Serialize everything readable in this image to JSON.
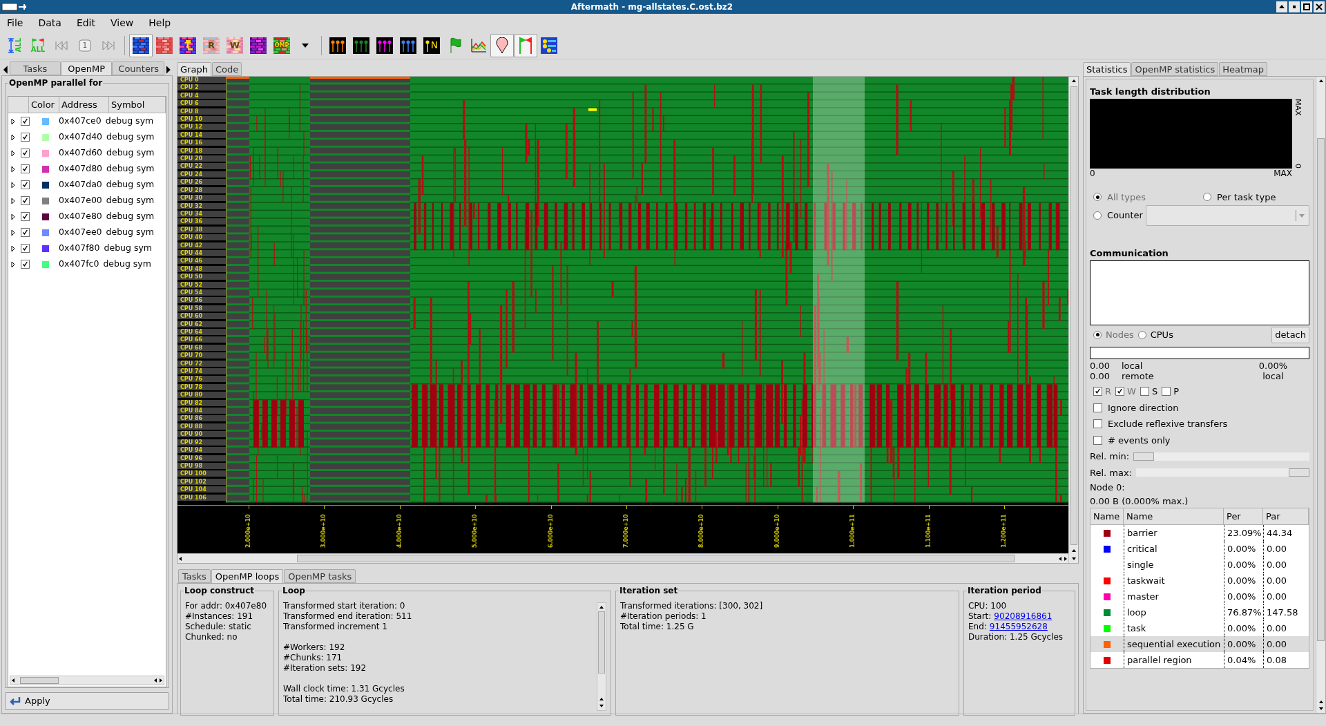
{
  "window": {
    "title": "Aftermath - mg-allstates.C.ost.bz2"
  },
  "menu": [
    "File",
    "Data",
    "Edit",
    "View",
    "Help"
  ],
  "toolbar": [
    {
      "kind": "all-range",
      "label": "ALL",
      "selected": false
    },
    {
      "kind": "all-flags",
      "label": "ALL",
      "selected": false
    },
    {
      "kind": "skip-start",
      "selected": false
    },
    {
      "kind": "page",
      "label": "1",
      "selected": false
    },
    {
      "kind": "skip-end",
      "selected": false
    },
    {
      "kind": "sep"
    },
    {
      "kind": "mode-state",
      "selected": true
    },
    {
      "kind": "mode-type",
      "selected": false
    },
    {
      "kind": "mode-typed",
      "label": "T",
      "selected": false
    },
    {
      "kind": "mode-read",
      "label": "R",
      "selected": false
    },
    {
      "kind": "mode-write",
      "label": "W",
      "selected": false
    },
    {
      "kind": "mode-numa",
      "selected": false
    },
    {
      "kind": "mode-omp",
      "label": "OMP",
      "selected": false
    },
    {
      "kind": "dropdown",
      "selected": false
    },
    {
      "kind": "sep"
    },
    {
      "kind": "pins-orange",
      "selected": false
    },
    {
      "kind": "pins-green",
      "selected": false
    },
    {
      "kind": "pins-magenta",
      "selected": false
    },
    {
      "kind": "pins-blue",
      "selected": false
    },
    {
      "kind": "pins-n",
      "label": "N",
      "selected": false
    },
    {
      "kind": "flag",
      "selected": false
    },
    {
      "kind": "chart",
      "selected": false
    },
    {
      "kind": "marker",
      "selected": true
    },
    {
      "kind": "flags",
      "selected": true
    },
    {
      "kind": "overview",
      "selected": false
    }
  ],
  "left_tabs": [
    {
      "label": "Tasks",
      "selected": false
    },
    {
      "label": "OpenMP",
      "selected": true
    },
    {
      "label": "Counters",
      "selected": false
    }
  ],
  "openmp_panel": {
    "title": "OpenMP parallel for",
    "columns": [
      "Color",
      "Address",
      "Symbol"
    ],
    "rows": [
      {
        "checked": true,
        "color": "#66bbff",
        "address": "0x407ce0",
        "symbol": "debug sym"
      },
      {
        "checked": true,
        "color": "#b0ffa8",
        "address": "0x407d40",
        "symbol": "debug sym"
      },
      {
        "checked": true,
        "color": "#ffa0cc",
        "address": "0x407d60",
        "symbol": "debug sym"
      },
      {
        "checked": true,
        "color": "#d030b0",
        "address": "0x407d80",
        "symbol": "debug sym"
      },
      {
        "checked": true,
        "color": "#003060",
        "address": "0x407da0",
        "symbol": "debug sym"
      },
      {
        "checked": true,
        "color": "#808080",
        "address": "0x407e00",
        "symbol": "debug sym"
      },
      {
        "checked": true,
        "color": "#600040",
        "address": "0x407e80",
        "symbol": "debug sym"
      },
      {
        "checked": true,
        "color": "#7088ff",
        "address": "0x407ee0",
        "symbol": "debug sym"
      },
      {
        "checked": true,
        "color": "#6030ff",
        "address": "0x407f80",
        "symbol": "debug sym"
      },
      {
        "checked": true,
        "color": "#40ff80",
        "address": "0x407fc0",
        "symbol": "debug sym"
      }
    ],
    "apply": "Apply"
  },
  "graph_tabs": [
    {
      "label": "Graph",
      "selected": true
    },
    {
      "label": "Code",
      "selected": false
    }
  ],
  "timeline": {
    "cpus": [
      "CPU 0",
      "CPU 2",
      "CPU 4",
      "CPU 6",
      "CPU 8",
      "CPU 10",
      "CPU 12",
      "CPU 14",
      "CPU 16",
      "CPU 18",
      "CPU 20",
      "CPU 22",
      "CPU 24",
      "CPU 26",
      "CPU 28",
      "CPU 30",
      "CPU 32",
      "CPU 34",
      "CPU 36",
      "CPU 38",
      "CPU 40",
      "CPU 42",
      "CPU 44",
      "CPU 46",
      "CPU 48",
      "CPU 50",
      "CPU 52",
      "CPU 54",
      "CPU 56",
      "CPU 58",
      "CPU 60",
      "CPU 62",
      "CPU 64",
      "CPU 66",
      "CPU 68",
      "CPU 70",
      "CPU 72",
      "CPU 74",
      "CPU 76",
      "CPU 78",
      "CPU 80",
      "CPU 82",
      "CPU 84",
      "CPU 86",
      "CPU 88",
      "CPU 90",
      "CPU 92",
      "CPU 94",
      "CPU 96",
      "CPU 98",
      "CPU 100",
      "CPU 102",
      "CPU 104",
      "CPU 106"
    ],
    "axis": [
      "2.000e+10",
      "3.000e+10",
      "4.000e+10",
      "5.000e+10",
      "6.000e+10",
      "7.000e+10",
      "8.000e+10",
      "9.000e+10",
      "1.000e+11",
      "1.100e+11",
      "1.200e+11"
    ]
  },
  "bottom_tabs": [
    {
      "label": "Tasks",
      "selected": false
    },
    {
      "label": "OpenMP loops",
      "selected": true
    },
    {
      "label": "OpenMP tasks",
      "selected": false
    }
  ],
  "loop_construct": {
    "title": "Loop construct",
    "lines": [
      "For addr: 0x407e80",
      "#Instances: 191",
      "Schedule: static",
      "Chunked: no"
    ]
  },
  "loop": {
    "title": "Loop",
    "paragraphs": [
      [
        "Transformed start iteration: 0",
        "Transformed end iteration: 511",
        "Transformed increment 1"
      ],
      [
        "#Workers: 192",
        "#Chunks: 171",
        "#Iteration sets: 192"
      ],
      [
        "Wall clock time: 1.31 Gcycles",
        "Total time: 210.93 Gcycles"
      ]
    ]
  },
  "iteration_set": {
    "title": "Iteration set",
    "lines": [
      "Transformed iterations: [300, 302]",
      "#Iteration periods: 1",
      "Total time: 1.25 G"
    ]
  },
  "iteration_period": {
    "title": "Iteration period",
    "lines": [
      {
        "text": "CPU: 100"
      },
      {
        "text": "Start:",
        "link": "90208916861"
      },
      {
        "text": "End:",
        "link": "91455952628"
      },
      {
        "text": "Duration: 1.25 Gcycles"
      }
    ]
  },
  "right_tabs": [
    {
      "label": "Statistics",
      "selected": true
    },
    {
      "label": "OpenMP statistics",
      "selected": false
    },
    {
      "label": "Heatmap",
      "selected": false
    }
  ],
  "task_length": {
    "title": "Task length distribution",
    "x_min": "0",
    "x_max": "MAX",
    "y_min": "0",
    "y_max": "MAX"
  },
  "type_options": [
    {
      "label": "All types",
      "selected": true
    },
    {
      "label": "Per task type",
      "selected": false
    },
    {
      "label": "Counter",
      "selected": false
    }
  ],
  "communication": {
    "title": "Communication",
    "scope": [
      {
        "label": "Nodes",
        "selected": true
      },
      {
        "label": "CPUs",
        "selected": false
      }
    ],
    "detach": "detach",
    "local_value": "0.00",
    "local_label": "local",
    "remote_value": "0.00",
    "remote_label": "remote",
    "percent": "0.00%",
    "percent_label": "local",
    "access": [
      {
        "label": "R",
        "checked": true
      },
      {
        "label": "W",
        "checked": true
      },
      {
        "label": "S",
        "checked": false
      },
      {
        "label": "P",
        "checked": false
      }
    ],
    "options": [
      {
        "label": "Ignore direction",
        "checked": false
      },
      {
        "label": "Exclude reflexive transfers",
        "checked": false
      },
      {
        "label": "# events only",
        "checked": false
      }
    ],
    "rel_min": {
      "label": "Rel. min:",
      "level": 0
    },
    "rel_max": {
      "label": "Rel. max:",
      "level": 1
    },
    "node_title": "Node 0:",
    "node_value": "0.00 B (0.000% max.)"
  },
  "stats_table": {
    "columns": [
      "Name",
      "Name",
      "Per",
      "Par"
    ],
    "rows": [
      {
        "color": "#a00014",
        "name": "barrier",
        "per": "23.09%",
        "par": "44.34",
        "selected": false
      },
      {
        "color": "#0000ff",
        "name": "critical",
        "per": "0.00%",
        "par": "0.00",
        "selected": false
      },
      {
        "name": "single",
        "per": "0.00%",
        "par": "0.00",
        "selected": false
      },
      {
        "color": "#ff0000",
        "name": "taskwait",
        "per": "0.00%",
        "par": "0.00",
        "selected": false
      },
      {
        "color": "#ff00b0",
        "name": "master",
        "per": "0.00%",
        "par": "0.00",
        "selected": false
      },
      {
        "color": "#008c30",
        "name": "loop",
        "per": "76.87%",
        "par": "147.58",
        "selected": false
      },
      {
        "color": "#00ff00",
        "name": "task",
        "per": "0.00%",
        "par": "0.00",
        "selected": false
      },
      {
        "color": "#ff6000",
        "name": "sequential execution",
        "per": "0.00%",
        "par": "0.00",
        "selected": true
      },
      {
        "color": "#e00000",
        "name": "parallel region",
        "per": "0.04%",
        "par": "0.08",
        "selected": false
      }
    ]
  }
}
